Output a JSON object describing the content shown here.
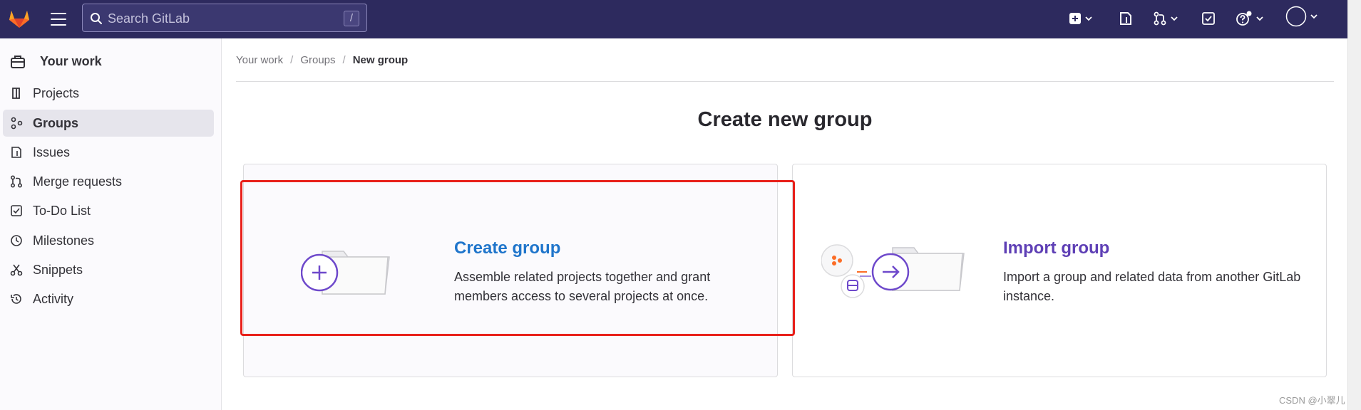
{
  "header": {
    "search_placeholder": "Search GitLab",
    "search_shortcut": "/",
    "icons": [
      "gitlab-logo",
      "hamburger-menu-icon",
      "search-icon",
      "plus-square-icon",
      "issues-icon",
      "merge-request-icon",
      "todo-icon",
      "help-icon",
      "avatar"
    ],
    "brand_color": "#2d2a5e"
  },
  "sidebar": {
    "header_label": "Your work",
    "items": [
      {
        "label": "Projects",
        "icon": "project-icon"
      },
      {
        "label": "Groups",
        "icon": "group-icon",
        "active": true
      },
      {
        "label": "Issues",
        "icon": "issues-icon"
      },
      {
        "label": "Merge requests",
        "icon": "merge-request-icon"
      },
      {
        "label": "To-Do List",
        "icon": "todo-icon"
      },
      {
        "label": "Milestones",
        "icon": "clock-icon"
      },
      {
        "label": "Snippets",
        "icon": "scissors-icon"
      },
      {
        "label": "Activity",
        "icon": "history-icon"
      }
    ]
  },
  "breadcrumb": {
    "items": [
      "Your work",
      "Groups",
      "New group"
    ]
  },
  "main": {
    "title": "Create new group",
    "cards": [
      {
        "title": "Create group",
        "description_line1": "Assemble related projects together and grant",
        "description_line2": "members access to several projects at once.",
        "title_color": "#1f75cb"
      },
      {
        "title": "Import group",
        "description_line1": "Import a group and related data from another GitLab",
        "description_line2": "instance.",
        "title_color": "#5e3fb5"
      }
    ]
  },
  "watermark": "CSDN @小翠儿"
}
